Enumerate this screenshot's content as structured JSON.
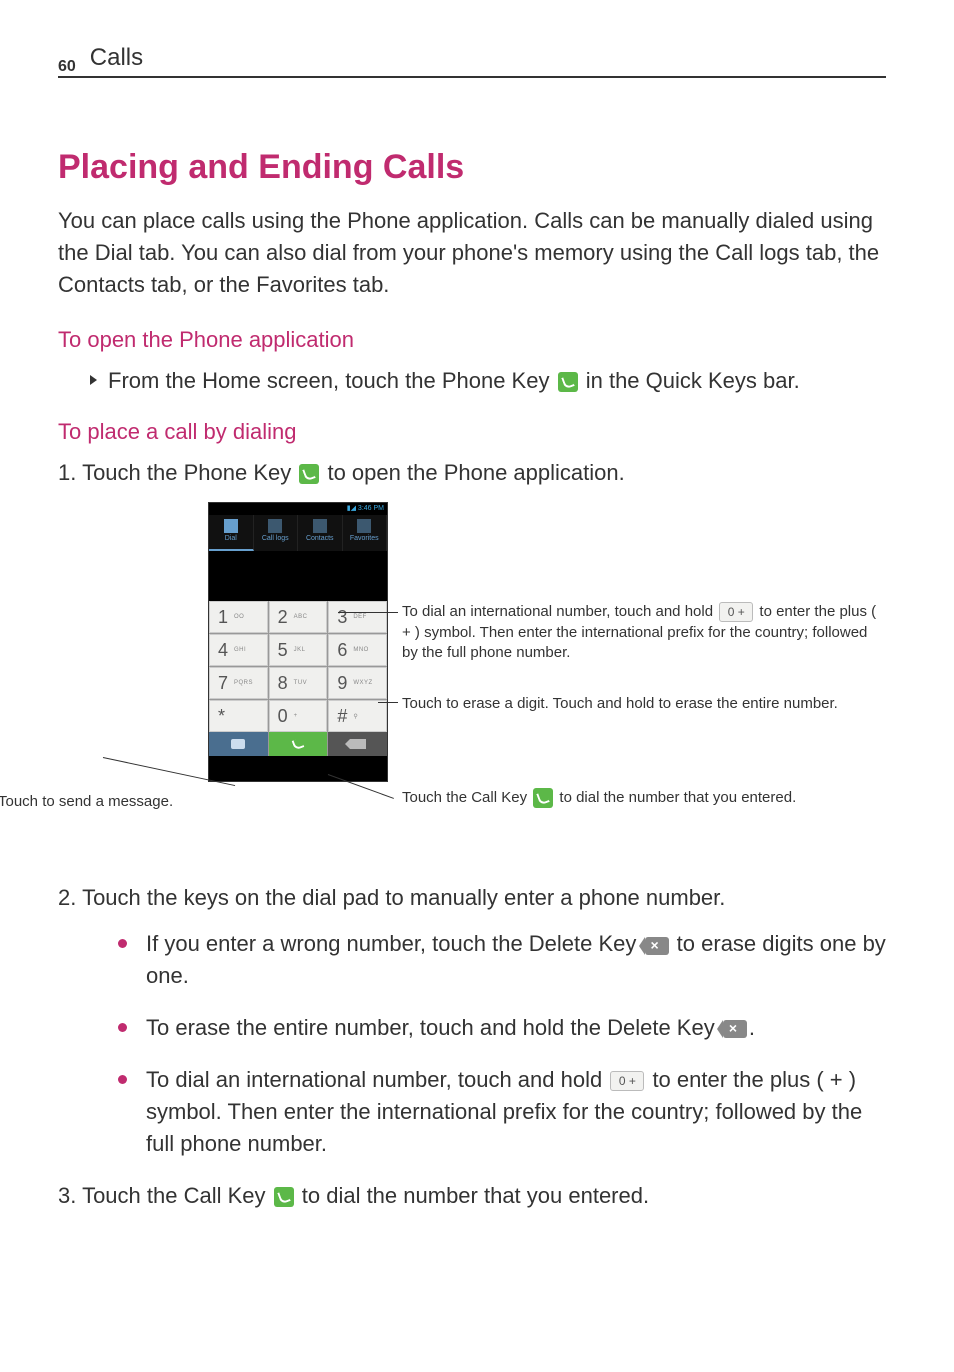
{
  "header": {
    "page_number": "60",
    "section": "Calls"
  },
  "title": "Placing and Ending Calls",
  "intro": {
    "t1": "You can place calls using the ",
    "b1": "Phone",
    "t2": " application. Calls can be manually dialed using the ",
    "b2": "Dial",
    "t3": " tab. You can also dial from your phone's memory using the ",
    "b3": "Call logs",
    "t4": " tab, the ",
    "b4": "Contacts",
    "t5": " tab, or the ",
    "b5": "Favorites",
    "t6": " tab."
  },
  "sub1": "To open the Phone application",
  "instr1": {
    "t1": "From the Home screen, touch the ",
    "b1": "Phone Key",
    "t2": " in the Quick Keys bar."
  },
  "sub2": "To place a call by dialing",
  "step1": {
    "num": "1.",
    "t1": " Touch the ",
    "b1": "Phone Key",
    "t2": " to open the ",
    "b2": "Phone",
    "t3": " application."
  },
  "diagram": {
    "status_time": "3:46 PM",
    "tabs": {
      "dial": "Dial",
      "logs": "Call logs",
      "contacts": "Contacts",
      "fav": "Favorites"
    },
    "keys": {
      "k1": "1",
      "s1": "OO",
      "k2": "2",
      "s2": "ABC",
      "k3": "3",
      "s3": "DEF",
      "k4": "4",
      "s4": "GHI",
      "k5": "5",
      "s5": "JKL",
      "k6": "6",
      "s6": "MNO",
      "k7": "7",
      "s7": "PQRS",
      "k8": "8",
      "s8": "TUV",
      "k9": "9",
      "s9": "WXYZ",
      "kstar": "*",
      "k0": "0",
      "s0": "+",
      "khash": "#"
    },
    "callouts": {
      "msg": "Touch to send a message.",
      "intl_t1": "To dial an international number, touch and hold ",
      "intl_t2": " to enter the plus ( + ) symbol. Then enter the international prefix for the country; followed by the full phone number.",
      "erase": "Touch to erase a digit. Touch and hold to erase the entire number.",
      "call_t1": "Touch the ",
      "call_b1": "Call Key",
      "call_t2": " to dial the number that you entered."
    }
  },
  "step2": {
    "num": "2.",
    "text": " Touch the keys on the dial pad to manually enter a phone number."
  },
  "bullets": {
    "b1": {
      "t1": "If you enter a wrong number, touch the ",
      "bold1": "Delete Key",
      "t2": " to erase digits one by one."
    },
    "b2": {
      "t1": "To erase the entire number, touch and hold the ",
      "bold1": "Delete Key",
      "t2": "."
    },
    "b3": {
      "t1": "To dial an international number, touch and hold ",
      "t2": " to enter the plus ( + ) symbol. Then enter the international prefix for the country; followed by the full phone number."
    }
  },
  "step3": {
    "num": "3.",
    "t1": " Touch the ",
    "b1": "Call Key",
    "t2": " to dial the number that you entered."
  }
}
